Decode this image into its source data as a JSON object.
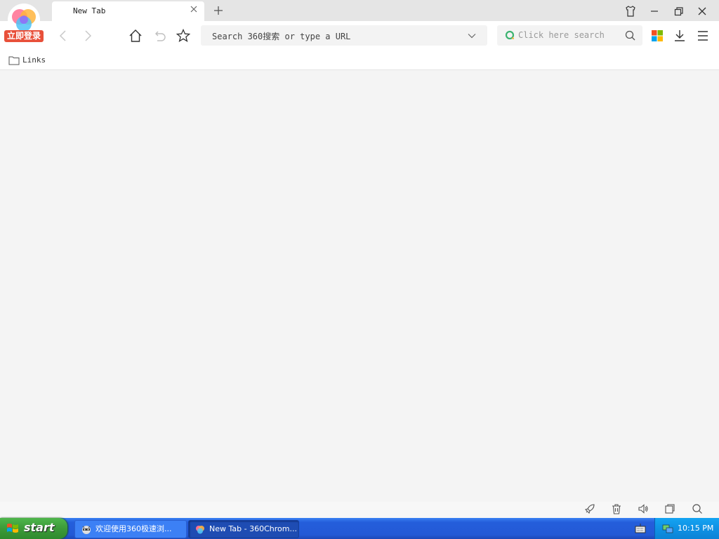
{
  "browser": {
    "tab_title": "New Tab",
    "login_badge": "立即登录",
    "url_placeholder": "Search 360搜索 or type a URL",
    "search_placeholder": "Click here search",
    "bookmarks": [
      {
        "label": "Links",
        "icon": "folder-icon"
      }
    ]
  },
  "toolbar_icons": [
    "back-icon",
    "forward-icon",
    "home-icon",
    "undo-icon",
    "star-icon"
  ],
  "right_icons": [
    "app-grid-icon",
    "download-icon",
    "menu-icon"
  ],
  "window_controls": [
    "skin-icon",
    "minimize-icon",
    "restore-icon",
    "close-icon"
  ],
  "status_icons": [
    "rocket-icon",
    "trash-icon",
    "speaker-icon",
    "window-icon",
    "search-icon"
  ],
  "taskbar": {
    "start_label": "start",
    "tasks": [
      {
        "label": "欢迎使用360极速浏...",
        "active": false
      },
      {
        "label": "New Tab - 360Chrom...",
        "active": true
      }
    ],
    "clock": "10:15 PM"
  },
  "colors": {
    "login_badge": "#e8503a",
    "taskbar": "#245edb",
    "start": "#3c9a39",
    "tray": "#0f91e4"
  }
}
